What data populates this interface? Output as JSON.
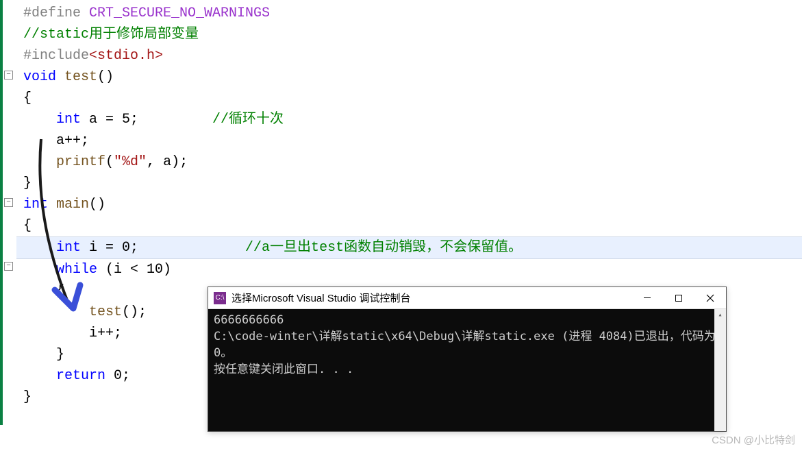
{
  "code": {
    "line1_define": "#define",
    "line1_macro": " CRT_SECURE_NO_WARNINGS",
    "line2": "//static用于修饰局部变量",
    "line3_include": "#include",
    "line3_lt": "<",
    "line3_hdr": "stdio.h",
    "line3_gt": ">",
    "line4_void": "void",
    "line4_func": " test",
    "line4_paren": "()",
    "line5": "{",
    "line6_type": "    int",
    "line6_var": " a = 5;",
    "line6_comment": "         //循环十次",
    "line7": "    a++;",
    "line8_func": "    printf",
    "line8_open": "(",
    "line8_str": "\"%d\"",
    "line8_rest": ", a);",
    "line9": "}",
    "line10_int": "int",
    "line10_main": " main",
    "line10_paren": "()",
    "line11": "{",
    "line12_type": "    int",
    "line12_var": " i = 0;",
    "line12_comment": "             //a一旦出test函数自动销毁，不会保留值。",
    "line13_while": "    while",
    "line13_cond": " (i < 10)",
    "line14": "    {",
    "line15_call": "        test",
    "line15_paren": "();",
    "line16": "        i++;",
    "line17": "    }",
    "line18_ret": "    return",
    "line18_val": " 0;",
    "line19": "}"
  },
  "console": {
    "title": "选择Microsoft Visual Studio 调试控制台",
    "icon_text": "C:\\",
    "line1": "6666666666",
    "line2": "C:\\code-winter\\详解static\\x64\\Debug\\详解static.exe (进程 4084)已退出，代码为 0。",
    "line3": "按任意键关闭此窗口. . ."
  },
  "watermark": "CSDN @小比特剑",
  "fold_minus": "−"
}
